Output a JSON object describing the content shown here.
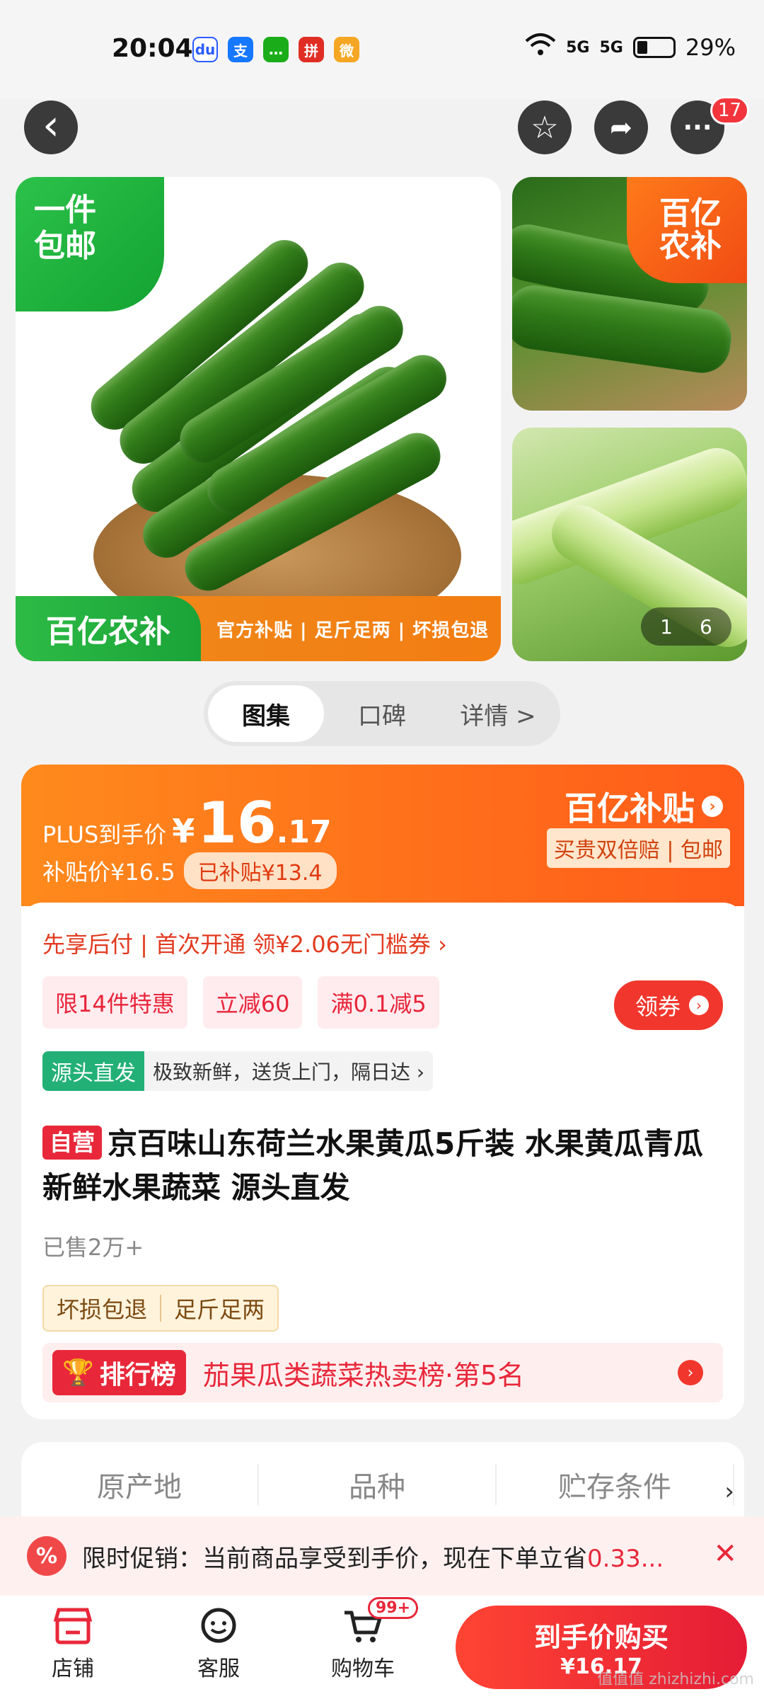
{
  "status_bar": {
    "time": "20:04",
    "apps": [
      {
        "name": "baidu-icon",
        "glyph": "du",
        "color": "#2a5cff"
      },
      {
        "name": "alipay-icon",
        "glyph": "支",
        "color": "#1677ff"
      },
      {
        "name": "wechat-msg-icon",
        "glyph": "…",
        "color": "#1aad19"
      },
      {
        "name": "pdd-icon",
        "glyph": "拼",
        "color": "#e02e24"
      },
      {
        "name": "weibo-icon",
        "glyph": "微",
        "color": "#f5a623"
      }
    ],
    "signal_1": "5G",
    "signal_2": "5G",
    "battery": "29%"
  },
  "nav": {
    "back_glyph": "‹",
    "favorite_glyph": "☆",
    "share_glyph": "➦",
    "more_glyph": "···",
    "more_badge": "17"
  },
  "gallery": {
    "corner_badge": "一件\n包邮",
    "logo": "百亿农补",
    "strip_tags": "官方补贴 | 足斤足两 | 坏损包退",
    "side_logo": "百亿\n农补",
    "pager_current": "1",
    "pager_total": "6"
  },
  "tabs": [
    {
      "label": "图集",
      "active": true
    },
    {
      "label": "口碑",
      "active": false
    },
    {
      "label": "详情 >",
      "active": false
    }
  ],
  "price": {
    "plus_label": "PLUS到手价",
    "currency": "¥",
    "integer": "16",
    "decimal": ".17",
    "subsidy_price": "补贴价¥16.5",
    "subsidized": "已补贴¥13.4",
    "brand_logo": "百亿补贴",
    "brand_tag": "买贵双倍赔 | 包邮"
  },
  "offers": {
    "credit_text": "先享后付 | 首次开通 领¥2.06无门槛券 ›",
    "promos": [
      "限14件特惠",
      "立减60",
      "满0.1减5"
    ],
    "coupon_button": "领券",
    "source_tag": "源头直发",
    "source_text": "极致新鲜，送货上门，隔日达 ›"
  },
  "product": {
    "self_tag": "自营",
    "title": "京百味山东荷兰水果黄瓜5斤装 水果黄瓜青瓜新鲜水果蔬菜 源头直发",
    "sold": "已售2万+",
    "guarantees": [
      "坏损包退",
      "足斤足两"
    ],
    "rank_tag": "排行榜",
    "rank_text": "茄果瓜类蔬菜热卖榜·第5名"
  },
  "attributes": [
    "原产地",
    "品种",
    "贮存条件"
  ],
  "banner": {
    "icon": "%",
    "text": "限时促销：当前商品享受到手价，现在下单立省",
    "highlight": "0.33...",
    "close": "✕"
  },
  "bottom_bar": {
    "shop": "店铺",
    "service": "客服",
    "cart": "购物车",
    "cart_badge": "99+",
    "buy_label": "到手价购买",
    "buy_price": "¥16.17"
  },
  "watermark": "值值值 zhizhizhi.com"
}
